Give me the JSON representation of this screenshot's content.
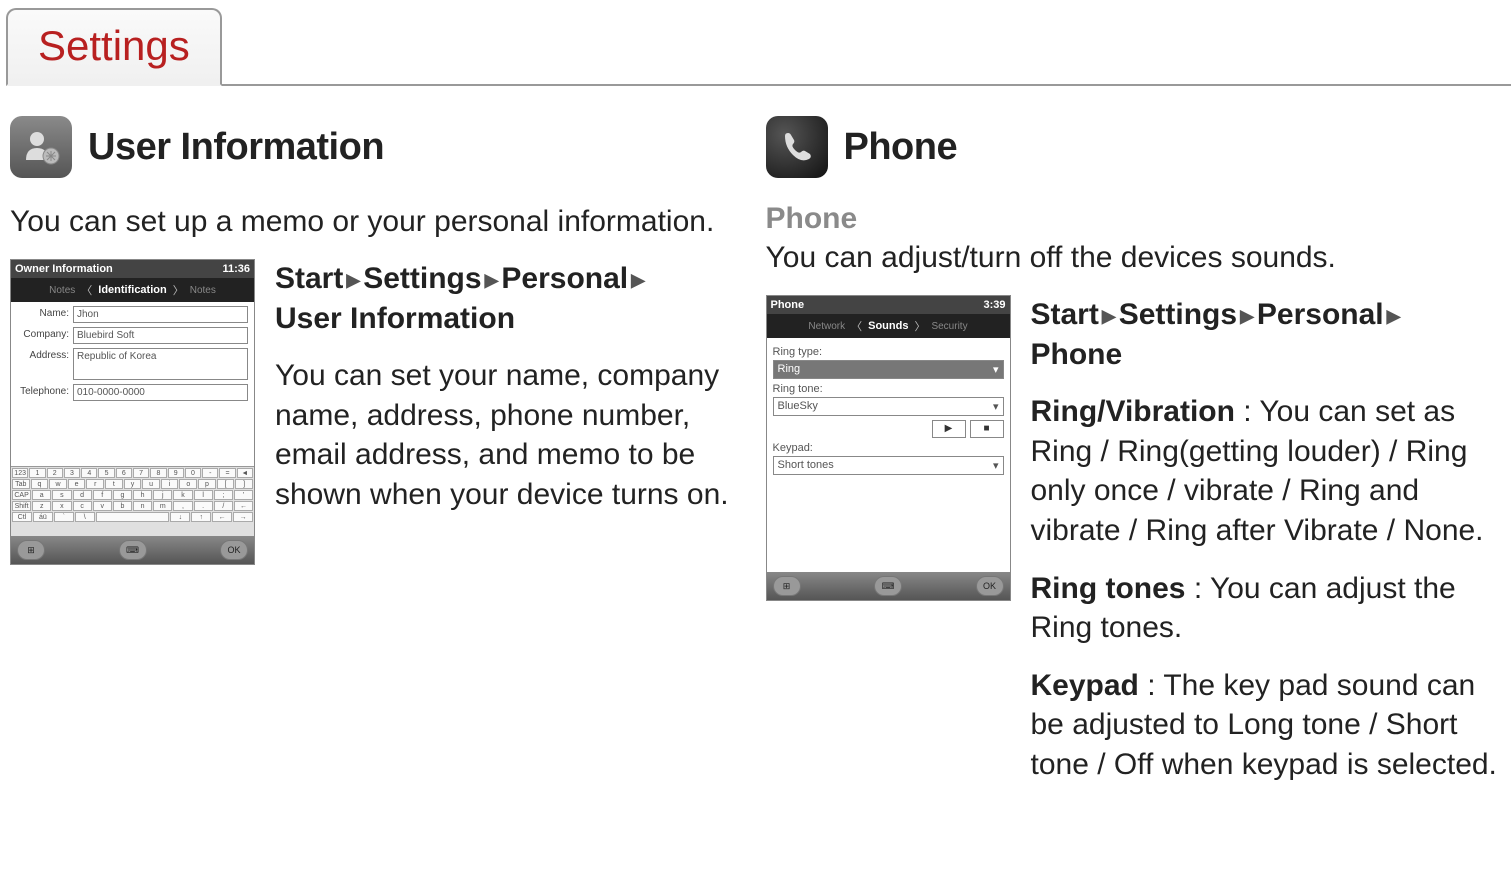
{
  "tab": {
    "label": "Settings"
  },
  "left": {
    "title": "User Information",
    "intro": "You can set up a memo or your personal information.",
    "path": [
      "Start",
      "Settings",
      "Personal",
      "User Information"
    ],
    "body": "You can set your name, company name, address, phone number, email address, and memo to be shown when your device turns on.",
    "screenshot": {
      "title": "Owner Information",
      "time": "11:36",
      "tab_left": "Notes",
      "tab_mid": "Identification",
      "tab_right": "Notes",
      "fields": {
        "name_label": "Name:",
        "name_value": "Jhon",
        "company_label": "Company:",
        "company_value": "Bluebird Soft",
        "address_label": "Address:",
        "address_value": "Republic of Korea",
        "telephone_label": "Telephone:",
        "telephone_value": "010-0000-0000"
      },
      "ok": "OK"
    }
  },
  "right": {
    "title": "Phone",
    "subhead": "Phone",
    "intro": "You can adjust/turn off the devices sounds.",
    "path": [
      "Start",
      "Settings",
      "Personal",
      "Phone"
    ],
    "items": {
      "ring_vibration_label": "Ring/Vibration",
      "ring_vibration_text": " : You can set as Ring / Ring(getting louder) / Ring only once / vibrate / Ring and vibrate / Ring after Vibrate / None.",
      "ring_tones_label": "Ring tones",
      "ring_tones_text": " : You can adjust the Ring tones.",
      "keypad_label": "Keypad",
      "keypad_text": " : The key pad sound can be adjusted to Long tone / Short tone / Off when keypad is selected."
    },
    "screenshot": {
      "title": "Phone",
      "time": "3:39",
      "tab_left": "Network",
      "tab_mid": "Sounds",
      "tab_right": "Security",
      "ring_type_label": "Ring type:",
      "ring_type_value": "Ring",
      "ring_tone_label": "Ring tone:",
      "ring_tone_value": "BlueSky",
      "keypad_label": "Keypad:",
      "keypad_value": "Short tones",
      "play": "▶",
      "stop": "■",
      "ok": "OK"
    }
  }
}
